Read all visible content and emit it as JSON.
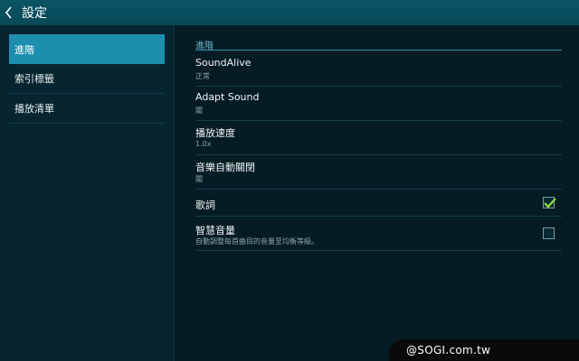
{
  "header": {
    "title": "設定"
  },
  "sidebar": {
    "items": [
      {
        "label": "進階",
        "active": true
      },
      {
        "label": "索引標籤",
        "active": false
      },
      {
        "label": "播放清單",
        "active": false
      }
    ]
  },
  "main": {
    "section_title": "進階",
    "settings": [
      {
        "title": "SoundAlive",
        "subtitle": "正常"
      },
      {
        "title": "Adapt Sound",
        "subtitle": "關"
      },
      {
        "title": "播放速度",
        "subtitle": "1.0x"
      },
      {
        "title": "音樂自動關閉",
        "subtitle": "關"
      },
      {
        "title": "歌詞",
        "checked": true
      },
      {
        "title": "智慧音量",
        "subtitle": "自動調整每首曲目的音量至均衡等級。",
        "checked": false
      }
    ]
  },
  "watermark": "@SOGI.com.tw",
  "colors": {
    "accent": "#1c8fb0",
    "titlebar": "#0a5564",
    "check": "#8ee03a"
  }
}
